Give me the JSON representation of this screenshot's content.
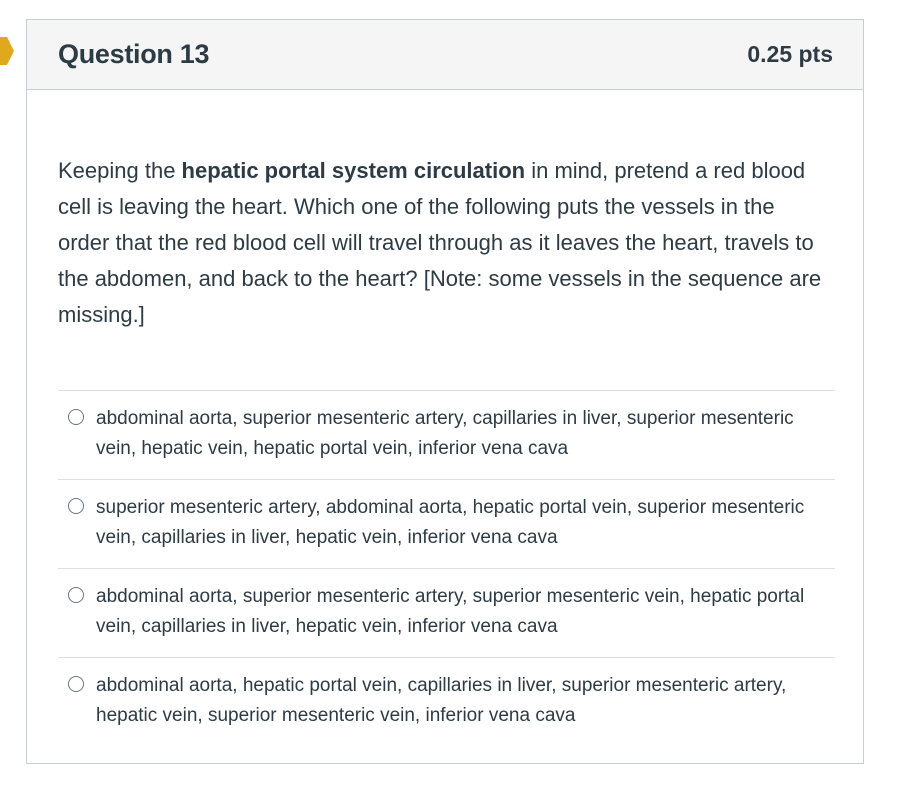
{
  "question": {
    "title": "Question 13",
    "points": "0.25 pts",
    "text_before": "Keeping the ",
    "text_bold": "hepatic portal system circulation",
    "text_after": " in mind, pretend a red blood cell is leaving the heart. Which one of the following puts the vessels in the order that the red blood cell will travel through as it leaves the heart, travels to the abdomen, and back to the heart?  [Note: some vessels in the sequence are missing.]"
  },
  "answers": [
    {
      "label": "abdominal aorta, superior mesenteric artery, capillaries in liver, superior mesenteric vein, hepatic vein, hepatic portal vein, inferior vena cava",
      "selected": false
    },
    {
      "label": "superior mesenteric artery, abdominal aorta, hepatic portal vein, superior mesenteric vein, capillaries in liver, hepatic vein, inferior vena cava",
      "selected": false
    },
    {
      "label": "abdominal aorta, superior mesenteric artery, superior mesenteric vein, hepatic portal vein, capillaries in liver, hepatic vein, inferior vena cava",
      "selected": false
    },
    {
      "label": "abdominal aorta, hepatic portal vein, capillaries in liver, superior mesenteric artery, hepatic vein, superior mesenteric vein, inferior vena cava",
      "selected": false
    }
  ],
  "colors": {
    "flag": "#e0a81c",
    "header_bg": "#f5f5f5",
    "text": "#2d3b45",
    "border": "#c7cdd1"
  },
  "icons": {
    "flag": "flag-marker-icon",
    "radio": "radio-button"
  }
}
